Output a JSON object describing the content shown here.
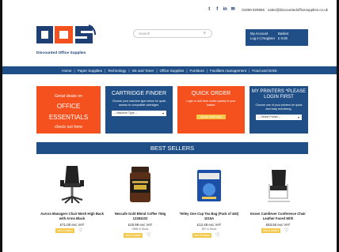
{
  "topbar": {
    "phone": "01969 829855",
    "email": "sales@discountedofficesupplies.co.uk"
  },
  "brand": {
    "logo_letters": "DOS",
    "name": "Discounted Office Supplies"
  },
  "search": {
    "placeholder": "Search"
  },
  "account": {
    "label": "My Account",
    "links": "Log in | Register",
    "basket_label": "Basket",
    "basket_total": "£ 0.00"
  },
  "nav": [
    "Home",
    "Paper Supplies",
    "Technology",
    "Ink and Toner",
    "Office Supplies",
    "Furniture",
    "Facilities management",
    "Food and Drink"
  ],
  "promos": {
    "deals_line1": "Great deals on",
    "deals_line2": "OFFICE",
    "deals_line3": "ESSENTIALS",
    "deals_cta": "check out here",
    "cartridge_title": "CARTRIDGE FINDER",
    "cartridge_desc": "Choose your machine type below for quick access to compatible cartridges.",
    "cartridge_select": "-- Machine Type --",
    "quick_title": "QUICK ORDER",
    "quick_desc": "Login to add item codes quickly to your basket.",
    "quick_button": "Quick order now",
    "printers_title": "MY PRINTERS *PLEASE LOGIN FIRST",
    "printers_desc": "Choose one of your printers for quick and easy reordering.",
    "printers_select": "-- Select Printer --"
  },
  "best_sellers": {
    "title": "BEST SELLERS",
    "products": [
      {
        "name": "Aurora Managers Chair Mesh High Back with Arms Black",
        "price": "£71.00 exc VAT",
        "stock": "",
        "button": "Add to basket"
      },
      {
        "name": "Nescafe Gold Blend Coffee 750g 12284102",
        "price": "£25.99 exc VAT",
        "stock": "2658 in Stock",
        "button": "Add to basket"
      },
      {
        "name": "Tetley One Cup Tea Bag (Pack of 440) 1015A",
        "price": "£12.49 exc VAT",
        "stock": "487 in Stock",
        "button": "Add to basket"
      },
      {
        "name": "Essen Cantilever Conference Chair Leather Faced With",
        "price": "£83.50 exc VAT",
        "stock": "",
        "button": "Add to basket"
      }
    ]
  },
  "colors": {
    "blue": "#1f4f86",
    "orange": "#f4511e",
    "yellow": "#f2c94c"
  }
}
